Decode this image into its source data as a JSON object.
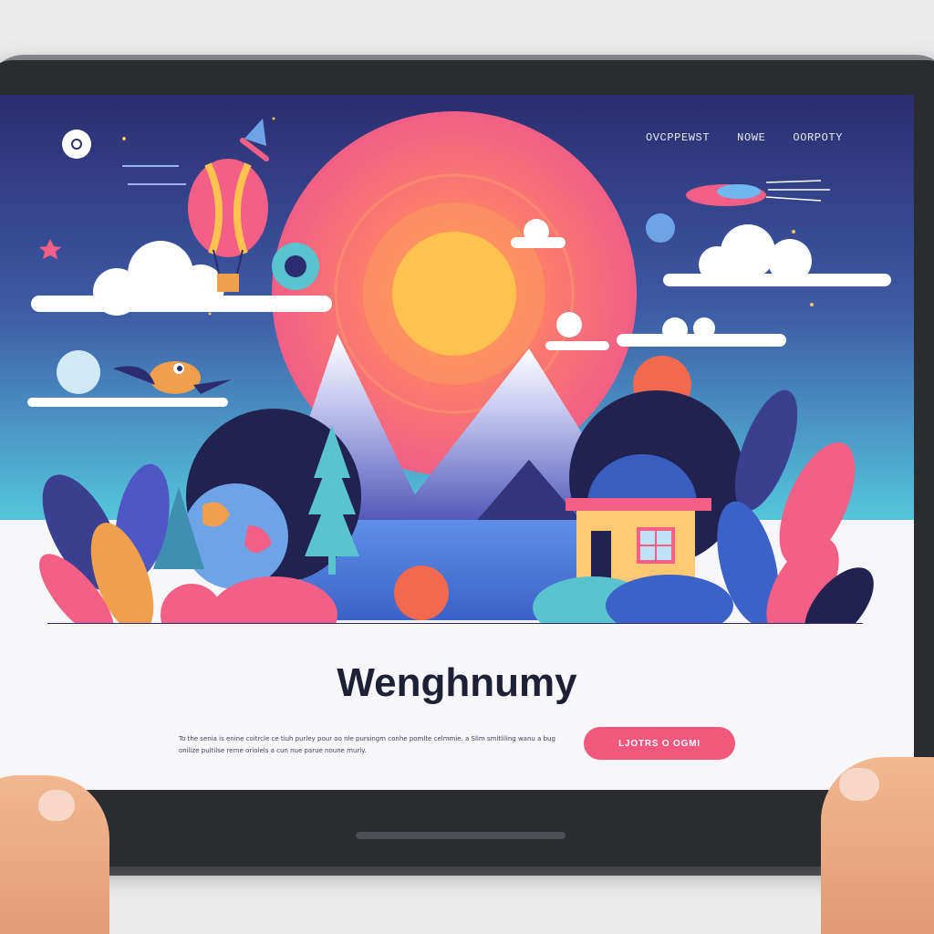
{
  "site": {
    "nav": [
      "OVCPPEWST",
      "NOWE",
      "OORPOTY"
    ],
    "headline": "Wenghnumy",
    "body_text": "To the senia is enine coitrcle ce tiuh purley pour oo nle pursingm conhe pomlte celmmie. a Slim smitliling wanu a bug onilize pultilse rerne oriolels a cun nue parue noune murly.",
    "cta_label": "LJOTRS O OGMI"
  },
  "colors": {
    "sky_top": "#2b2d6e",
    "sky_bottom": "#55c8dc",
    "sun_outer": "#f35f86",
    "sun_inner": "#ffc24f",
    "cta": "#f2577c",
    "headline": "#1e2036"
  },
  "icons": {
    "logo": "circle-logo-icon"
  }
}
